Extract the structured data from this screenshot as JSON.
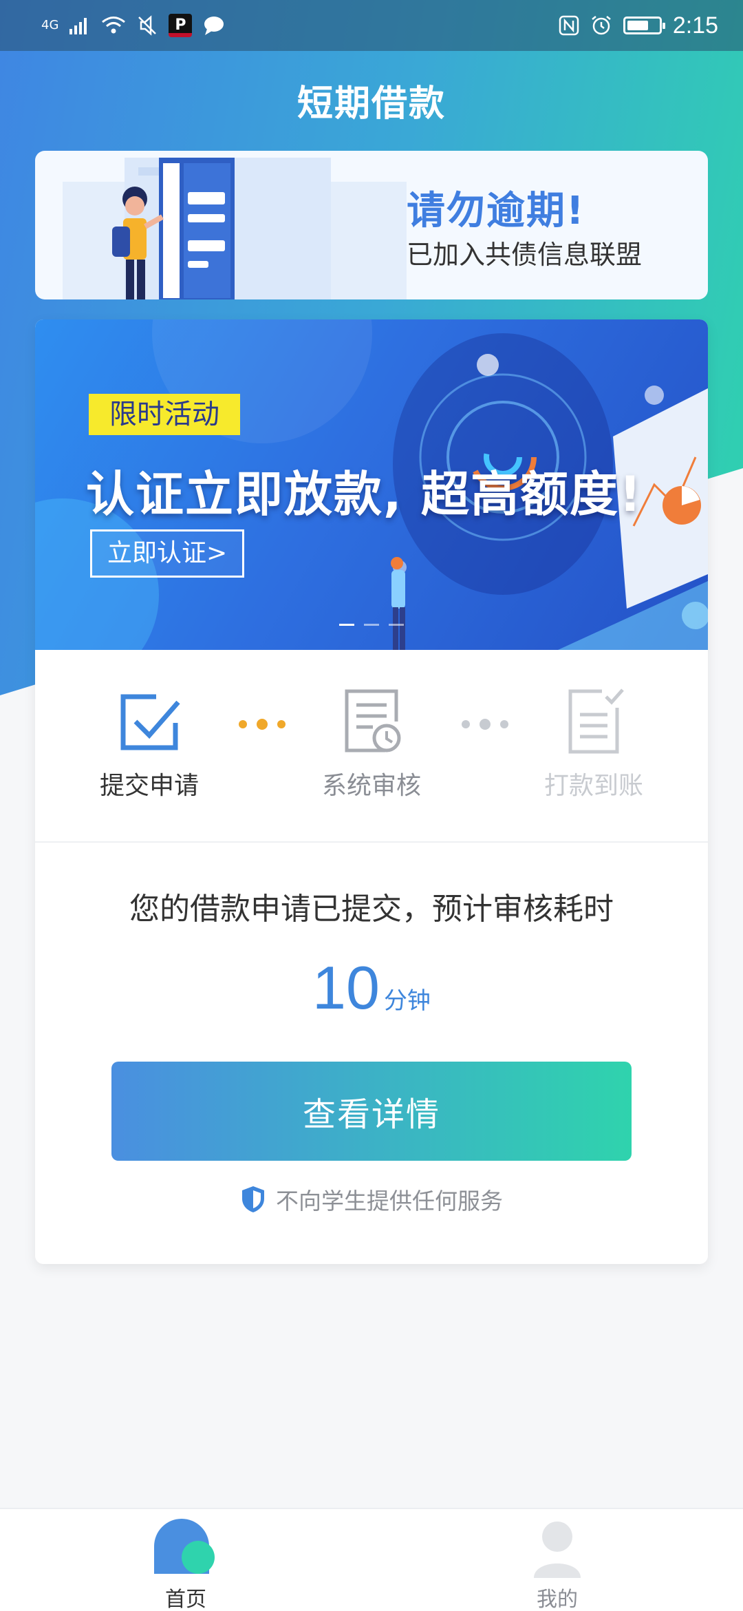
{
  "status_bar": {
    "network": "4G",
    "time": "2:15"
  },
  "page_title": "短期借款",
  "notice": {
    "title": "请勿逾期!",
    "subtitle": "已加入共债信息联盟"
  },
  "banner": {
    "tag": "限时活动",
    "headline": "认证立即放款, 超高额度!",
    "button": "立即认证>",
    "slides": 3,
    "active_slide": 1
  },
  "steps": [
    {
      "label": "提交申请",
      "state": "done",
      "icon": "checkbox-icon"
    },
    {
      "label": "系统审核",
      "state": "pending",
      "icon": "document-clock-icon"
    },
    {
      "label": "打款到账",
      "state": "inactive",
      "icon": "document-check-icon"
    }
  ],
  "status": {
    "message": "您的借款申请已提交，预计审核耗时",
    "eta_value": "10",
    "eta_unit": "分钟"
  },
  "detail_button": "查看详情",
  "disclaimer": "不向学生提供任何服务",
  "bottom_nav": {
    "home": "首页",
    "mine": "我的"
  },
  "colors": {
    "brand_blue": "#3f86e3",
    "brand_green": "#2fd3ad",
    "accent_orange": "#f0a82a",
    "tag_yellow": "#f7ea2c"
  }
}
